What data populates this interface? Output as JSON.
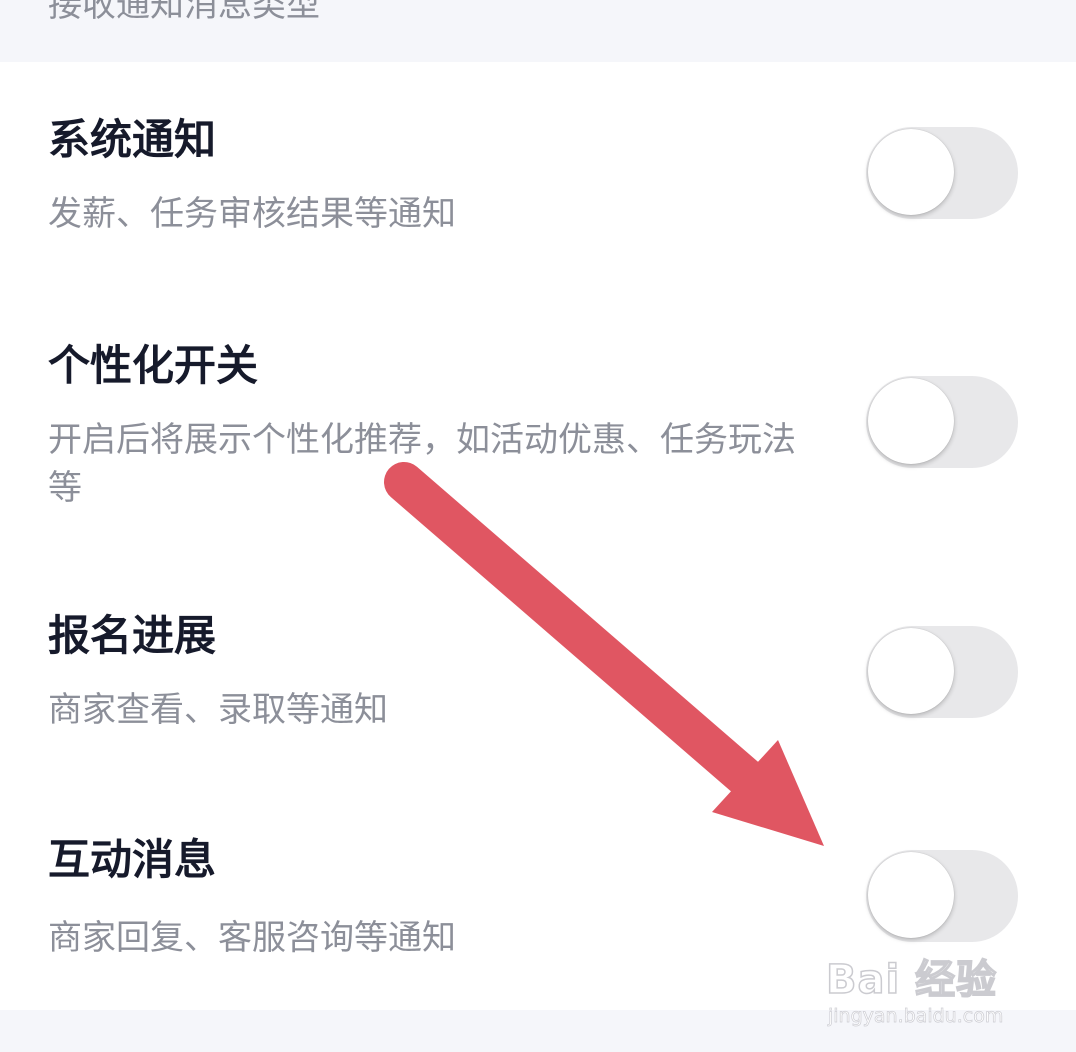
{
  "section": {
    "title": "接收通知消息类型"
  },
  "settings": [
    {
      "title": "系统通知",
      "description": "发薪、任务审核结果等通知",
      "enabled": false
    },
    {
      "title": "个性化开关",
      "description": "开启后将展示个性化推荐，如活动优惠、任务玩法等",
      "enabled": false
    },
    {
      "title": "报名进展",
      "description": "商家查看、录取等通知",
      "enabled": false
    },
    {
      "title": "互动消息",
      "description": "商家回复、客服咨询等通知",
      "enabled": false
    }
  ],
  "annotation": {
    "icon": "red-arrow-icon",
    "color": "#e05662"
  },
  "watermark": {
    "brand": "Bai 经验",
    "url": "jingyan.baidu.com"
  },
  "colors": {
    "title": "#161a2b",
    "description": "#8c8f99",
    "toggle_off": "#e8e8ea",
    "background": "#f5f6fa"
  }
}
